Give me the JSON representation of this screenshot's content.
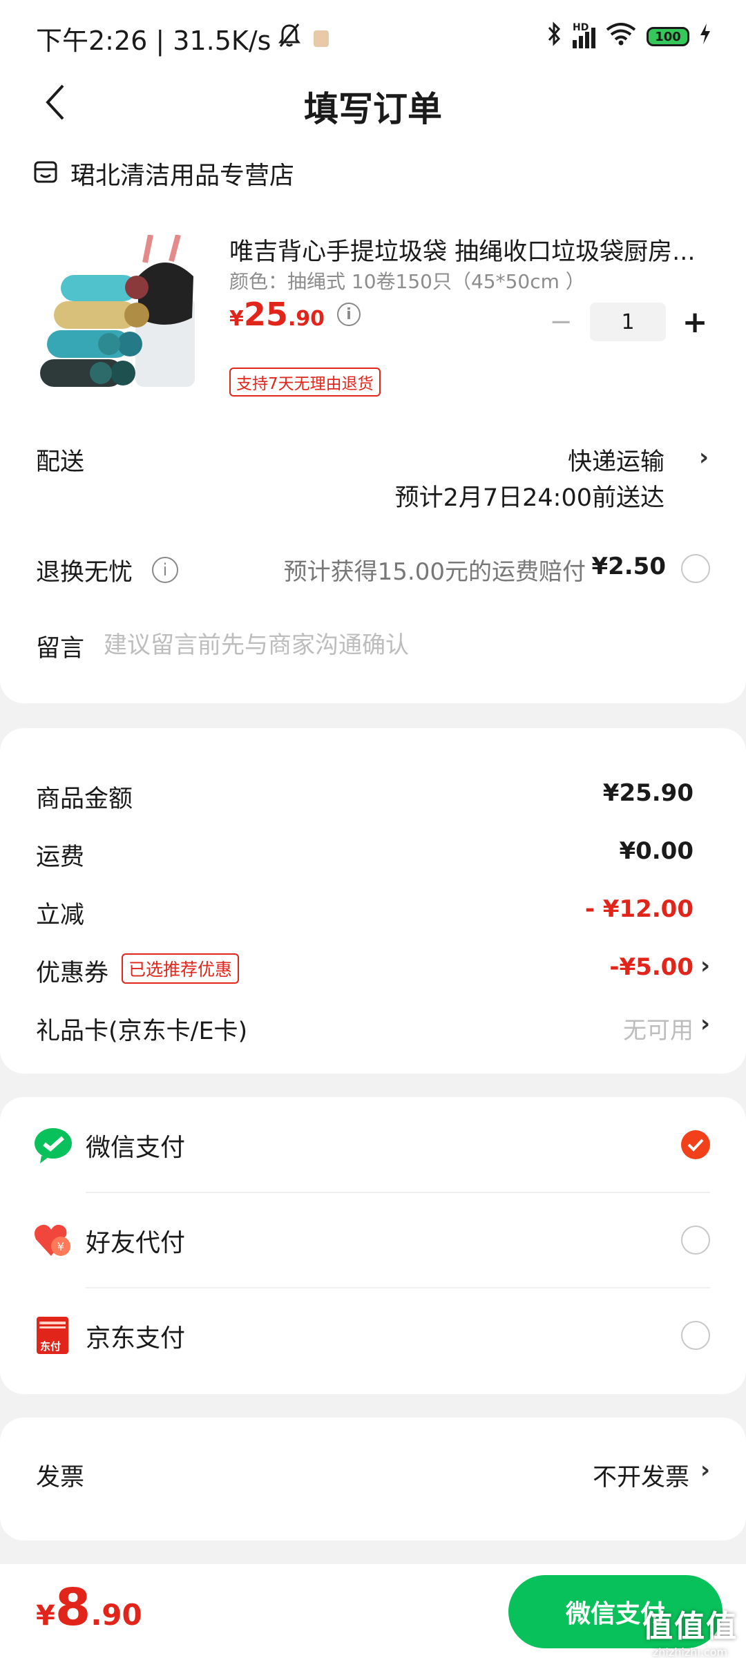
{
  "status_bar": {
    "time_speed": "下午2:26 | 31.5K/s",
    "network": "HD",
    "battery": "100"
  },
  "nav": {
    "title": "填写订单"
  },
  "store": {
    "name": "珺北清洁用品专营店"
  },
  "product": {
    "title": "唯吉背心手提垃圾袋 抽绳收口垃圾袋厨房...",
    "spec": "颜色：抽绳式 10卷150只（45*50cm ）",
    "price_currency": "¥",
    "price_int": "25",
    "price_dec": ".90",
    "quantity": "1",
    "return_tag": "支持7天无理由退货"
  },
  "delivery": {
    "label": "配送",
    "method": "快递运输",
    "eta": "预计2月7日24:00前送达"
  },
  "return_insurance": {
    "label": "退换无忧",
    "desc": "预计获得15.00元的运费赔付",
    "fee": "¥2.50"
  },
  "message": {
    "label": "留言",
    "placeholder": "建议留言前先与商家沟通确认",
    "value": ""
  },
  "summary": {
    "goods_label": "商品金额",
    "goods_value": "¥25.90",
    "shipping_label": "运费",
    "shipping_value": "¥0.00",
    "discount_label": "立减",
    "discount_value": "- ¥12.00",
    "coupon_label": "优惠券",
    "coupon_tag": "已选推荐优惠",
    "coupon_value": "-¥5.00",
    "giftcard_label": "礼品卡(京东卡/E卡)",
    "giftcard_value": "无可用"
  },
  "payment": {
    "methods": [
      {
        "label": "微信支付",
        "selected": true
      },
      {
        "label": "好友代付",
        "selected": false
      },
      {
        "label": "京东支付",
        "selected": false
      }
    ],
    "jd_icon_text": "东付"
  },
  "invoice": {
    "label": "发票",
    "value": "不开发票"
  },
  "bottom": {
    "total_currency": "¥",
    "total_int": "8",
    "total_dec": ".90",
    "pay_button": "微信支付"
  },
  "watermark": {
    "big": "值值值",
    "small": "zhizhizhi.com"
  },
  "colors": {
    "accent_red": "#e1251b",
    "wechat_green": "#09c15a",
    "radio_selected": "#f2401a"
  }
}
